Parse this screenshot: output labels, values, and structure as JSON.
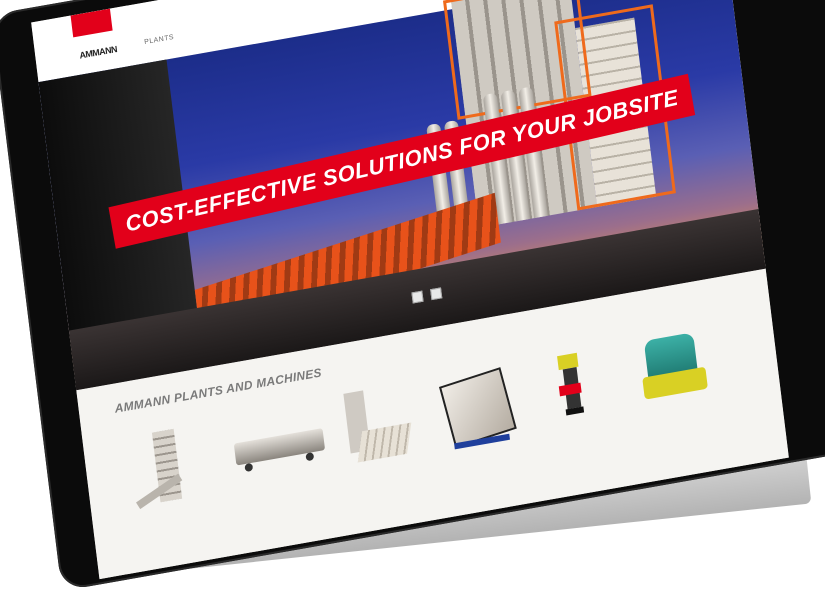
{
  "site": {
    "logo": "AMMANN",
    "nav": [
      "PLANTS"
    ]
  },
  "hero": {
    "headline": "COST-EFFECTIVE SOLUTIONS FOR YOUR JOBSITE",
    "slides": 2
  },
  "products": {
    "title": "AMMANN PLANTS AND MACHINES",
    "items": [
      {
        "icon": "asphalt-plant-icon"
      },
      {
        "icon": "mobile-plant-icon"
      },
      {
        "icon": "concrete-plant-icon"
      },
      {
        "icon": "compactor-plate-icon"
      },
      {
        "icon": "rammer-icon"
      },
      {
        "icon": "roller-icon"
      }
    ]
  },
  "colors": {
    "brand_red": "#e2001a",
    "accent_yellow": "#d9d024",
    "teal": "#2fa39a"
  }
}
